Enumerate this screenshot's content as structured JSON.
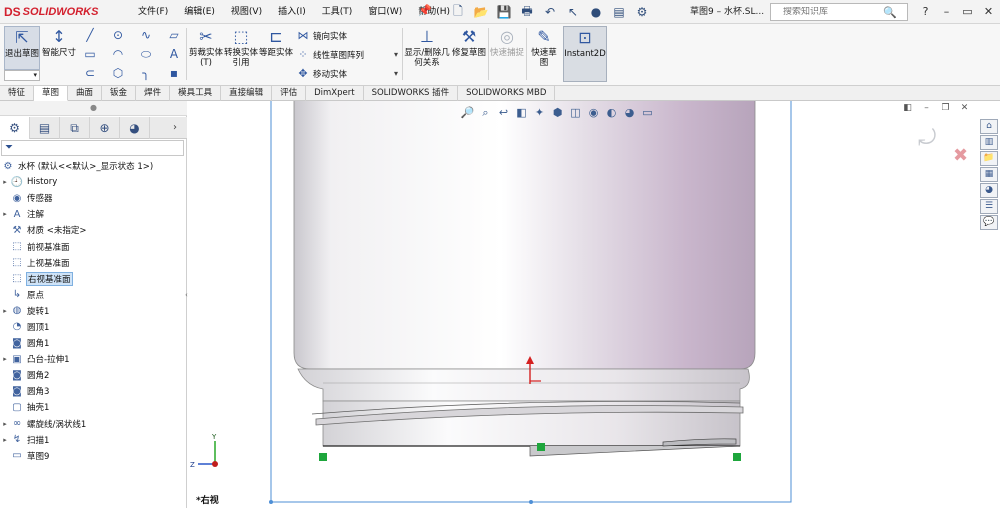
{
  "app": {
    "logo_ds": "DS",
    "logo_text": "SOLIDWORKS",
    "document_title": "草图9 – 水杯.SL..."
  },
  "menu": [
    "文件(F)",
    "编辑(E)",
    "视图(V)",
    "插入(I)",
    "工具(T)",
    "窗口(W)",
    "帮助(H)"
  ],
  "search": {
    "placeholder": "搜索知识库"
  },
  "window_buttons": [
    "?",
    "–",
    "▭",
    "✕"
  ],
  "ribbon": {
    "exit_sketch": "退出草图",
    "smart_dimension": "智能尺寸",
    "trim_entities": "剪裁实体(T)",
    "convert_entities": "转换实体引用",
    "offset_entities": "等距实体",
    "mirror_entities": "镜向实体",
    "linear_pattern": "线性草图阵列",
    "move_entities": "移动实体",
    "display_delete_relations": "显示/删除几何关系",
    "repair_sketch": "修复草图",
    "quick_snaps": "快速捕捉",
    "rapid_sketch": "快速草图",
    "instant2d": "Instant2D"
  },
  "tabs": [
    "特征",
    "草图",
    "曲面",
    "钣金",
    "焊件",
    "模具工具",
    "直接编辑",
    "评估",
    "DimXpert",
    "SOLIDWORKS 插件",
    "SOLIDWORKS MBD"
  ],
  "active_tab": "草图",
  "tree": {
    "root": "水杯 (默认<<默认>_显示状态 1>)",
    "items": [
      {
        "label": "History",
        "expandable": true,
        "icon": "history-icon"
      },
      {
        "label": "传感器",
        "expandable": false,
        "icon": "sensor-icon"
      },
      {
        "label": "注解",
        "expandable": true,
        "icon": "annotation-icon"
      },
      {
        "label": "材质 <未指定>",
        "expandable": false,
        "icon": "material-icon"
      },
      {
        "label": "前视基准面",
        "expandable": false,
        "icon": "plane-icon"
      },
      {
        "label": "上视基准面",
        "expandable": false,
        "icon": "plane-icon"
      },
      {
        "label": "右视基准面",
        "expandable": false,
        "icon": "plane-icon",
        "selected": true
      },
      {
        "label": "原点",
        "expandable": false,
        "icon": "origin-icon"
      },
      {
        "label": "旋转1",
        "expandable": true,
        "icon": "revolve-icon"
      },
      {
        "label": "圆顶1",
        "expandable": false,
        "icon": "dome-icon"
      },
      {
        "label": "圆角1",
        "expandable": false,
        "icon": "fillet-icon"
      },
      {
        "label": "凸台-拉伸1",
        "expandable": true,
        "icon": "extrude-icon"
      },
      {
        "label": "圆角2",
        "expandable": false,
        "icon": "fillet-icon"
      },
      {
        "label": "圆角3",
        "expandable": false,
        "icon": "fillet-icon"
      },
      {
        "label": "抽壳1",
        "expandable": false,
        "icon": "shell-icon"
      },
      {
        "label": "螺旋线/涡状线1",
        "expandable": true,
        "icon": "helix-icon"
      },
      {
        "label": "扫描1",
        "expandable": true,
        "icon": "sweep-icon"
      },
      {
        "label": "草图9",
        "expandable": false,
        "icon": "sketch-icon"
      }
    ]
  },
  "viewport": {
    "view_name": "*右视"
  },
  "colors": {
    "accent": "#2f57a0",
    "brand": "#d3202e",
    "selection": "#cfe3f7",
    "sketch_point": "#22aa22"
  }
}
